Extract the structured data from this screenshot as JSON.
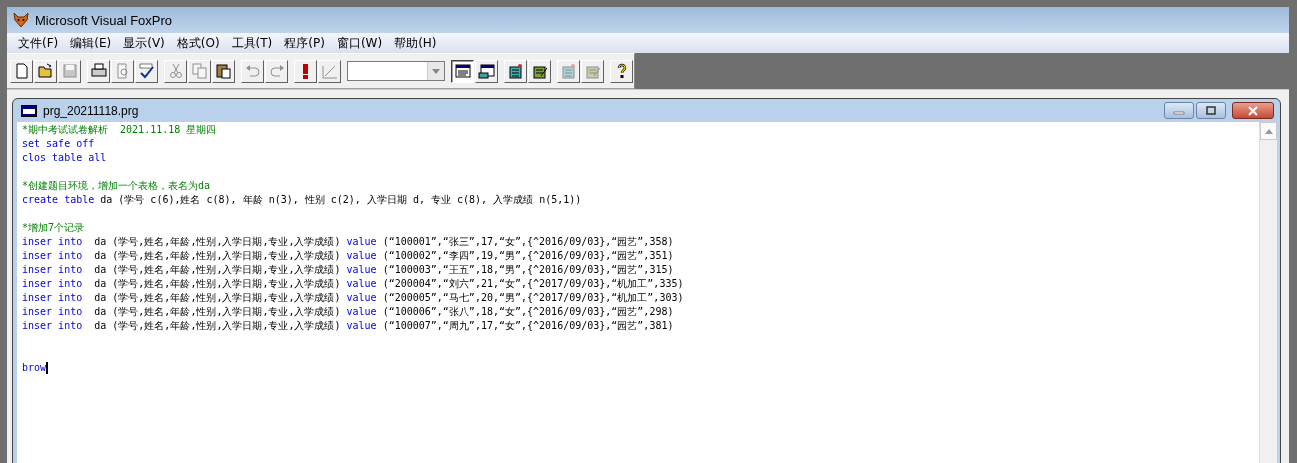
{
  "window": {
    "title": "Microsoft Visual FoxPro"
  },
  "menu": [
    "文件(F)",
    "编辑(E)",
    "显示(V)",
    "格式(O)",
    "工具(T)",
    "程序(P)",
    "窗口(W)",
    "帮助(H)"
  ],
  "toolbar": [
    [
      {
        "kind": "new",
        "disabled": false,
        "pressed": false
      },
      {
        "kind": "open",
        "disabled": false,
        "pressed": false
      },
      {
        "kind": "save",
        "disabled": true,
        "pressed": false
      }
    ],
    [
      {
        "kind": "print",
        "disabled": false,
        "pressed": false
      },
      {
        "kind": "preview",
        "disabled": true,
        "pressed": false
      },
      {
        "kind": "spell",
        "disabled": false,
        "pressed": false
      }
    ],
    [
      {
        "kind": "cut",
        "disabled": true,
        "pressed": false
      },
      {
        "kind": "copy",
        "disabled": true,
        "pressed": false
      },
      {
        "kind": "paste",
        "disabled": false,
        "pressed": false
      }
    ],
    [
      {
        "kind": "undo",
        "disabled": true,
        "pressed": false
      },
      {
        "kind": "redo",
        "disabled": true,
        "pressed": false
      }
    ],
    [
      {
        "kind": "run",
        "disabled": false,
        "pressed": false
      },
      {
        "kind": "modify",
        "disabled": true,
        "pressed": false
      }
    ],
    [
      {
        "kind": "combo"
      }
    ],
    [
      {
        "kind": "command",
        "disabled": false,
        "pressed": true
      },
      {
        "kind": "session",
        "disabled": false,
        "pressed": false
      }
    ],
    [
      {
        "kind": "form",
        "disabled": false,
        "pressed": false
      },
      {
        "kind": "report",
        "disabled": false,
        "pressed": false
      }
    ],
    [
      {
        "kind": "form",
        "disabled": true,
        "pressed": false
      },
      {
        "kind": "report",
        "disabled": true,
        "pressed": false
      }
    ],
    [
      {
        "kind": "help",
        "disabled": false,
        "pressed": false
      }
    ]
  ],
  "editor": {
    "title": "prg_20211118.prg",
    "lines": [
      {
        "kind": "code",
        "segments": [
          {
            "kind": "comment",
            "text": "*期中考试试卷解析  2021.11.18 星期四"
          }
        ]
      },
      {
        "kind": "code",
        "segments": [
          {
            "kind": "keyword",
            "text": "set safe off"
          }
        ]
      },
      {
        "kind": "code",
        "segments": [
          {
            "kind": "keyword",
            "text": "clos table all"
          }
        ]
      },
      {
        "kind": "blank"
      },
      {
        "kind": "code",
        "segments": [
          {
            "kind": "comment",
            "text": "*创建题目环境，增加一个表格，表名为da"
          }
        ]
      },
      {
        "kind": "code",
        "segments": [
          {
            "kind": "keyword",
            "text": "create table"
          },
          {
            "kind": "plain",
            "text": " da (学号 c(6),姓名 c(8), 年龄 n(3), 性别 c(2), 入学日期 d, 专业 c(8), 入学成绩 n(5,1))"
          }
        ]
      },
      {
        "kind": "blank"
      },
      {
        "kind": "code",
        "segments": [
          {
            "kind": "comment",
            "text": "*增加7个记录"
          }
        ]
      },
      {
        "kind": "code",
        "segments": [
          {
            "kind": "keyword",
            "text": "inser into"
          },
          {
            "kind": "plain",
            "text": "  da (学号,姓名,年龄,性别,入学日期,专业,入学成绩) "
          },
          {
            "kind": "keyword",
            "text": "value"
          },
          {
            "kind": "plain",
            "text": " (“100001”,“张三”,17,“女”,{^2016/09/03},“园艺”,358)"
          }
        ]
      },
      {
        "kind": "code",
        "segments": [
          {
            "kind": "keyword",
            "text": "inser into"
          },
          {
            "kind": "plain",
            "text": "  da (学号,姓名,年龄,性别,入学日期,专业,入学成绩) "
          },
          {
            "kind": "keyword",
            "text": "value"
          },
          {
            "kind": "plain",
            "text": " (“100002”,“李四”,19,“男”,{^2016/09/03},“园艺”,351)"
          }
        ]
      },
      {
        "kind": "code",
        "segments": [
          {
            "kind": "keyword",
            "text": "inser into"
          },
          {
            "kind": "plain",
            "text": "  da (学号,姓名,年龄,性别,入学日期,专业,入学成绩) "
          },
          {
            "kind": "keyword",
            "text": "value"
          },
          {
            "kind": "plain",
            "text": " (“100003”,“王五”,18,“男”,{^2016/09/03},“园艺”,315)"
          }
        ]
      },
      {
        "kind": "code",
        "segments": [
          {
            "kind": "keyword",
            "text": "inser into"
          },
          {
            "kind": "plain",
            "text": "  da (学号,姓名,年龄,性别,入学日期,专业,入学成绩) "
          },
          {
            "kind": "keyword",
            "text": "value"
          },
          {
            "kind": "plain",
            "text": " (“200004”,“刘六”,21,“女”,{^2017/09/03},“机加工”,335)"
          }
        ]
      },
      {
        "kind": "code",
        "segments": [
          {
            "kind": "keyword",
            "text": "inser into"
          },
          {
            "kind": "plain",
            "text": "  da (学号,姓名,年龄,性别,入学日期,专业,入学成绩) "
          },
          {
            "kind": "keyword",
            "text": "value"
          },
          {
            "kind": "plain",
            "text": " (“200005”,“马七”,20,“男”,{^2017/09/03},“机加工”,303)"
          }
        ]
      },
      {
        "kind": "code",
        "segments": [
          {
            "kind": "keyword",
            "text": "inser into"
          },
          {
            "kind": "plain",
            "text": "  da (学号,姓名,年龄,性别,入学日期,专业,入学成绩) "
          },
          {
            "kind": "keyword",
            "text": "value"
          },
          {
            "kind": "plain",
            "text": " (“100006”,“张八”,18,“女”,{^2016/09/03},“园艺”,298)"
          }
        ]
      },
      {
        "kind": "code",
        "segments": [
          {
            "kind": "keyword",
            "text": "inser into"
          },
          {
            "kind": "plain",
            "text": "  da (学号,姓名,年龄,性别,入学日期,专业,入学成绩) "
          },
          {
            "kind": "keyword",
            "text": "value"
          },
          {
            "kind": "plain",
            "text": " (“100007”,“周九”,17,“女”,{^2016/09/03},“园艺”,381)"
          }
        ]
      },
      {
        "kind": "blank"
      },
      {
        "kind": "blank"
      },
      {
        "kind": "code",
        "cursor": true,
        "segments": [
          {
            "kind": "keyword",
            "text": "brow"
          }
        ]
      }
    ]
  }
}
